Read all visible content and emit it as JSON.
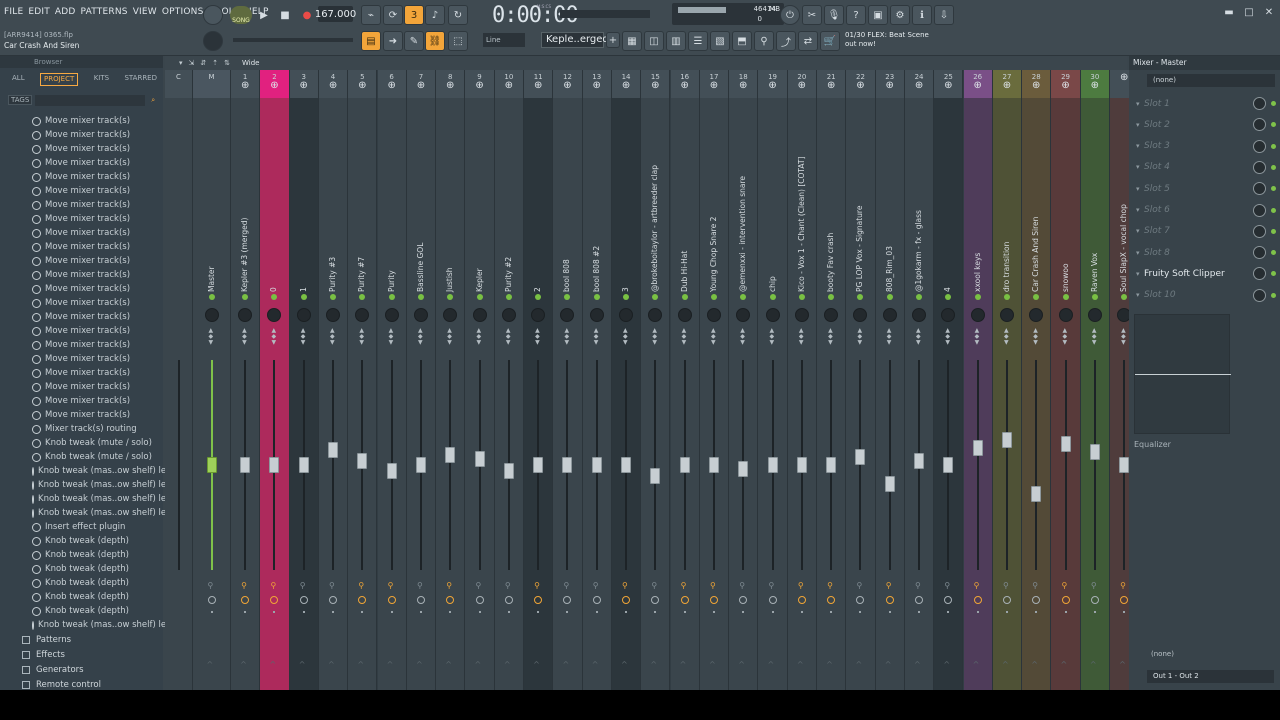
{
  "menu": [
    "FILE",
    "EDIT",
    "ADD",
    "PATTERNS",
    "VIEW",
    "OPTIONS",
    "TOOLS",
    "HELP"
  ],
  "transport": {
    "song_mode": "SONG",
    "tempo": "167.000",
    "time": "0:00:00",
    "time_unit": "M:S:CS",
    "memory_top": "14",
    "memory_label": "464 MB",
    "memory_bottom": "0"
  },
  "project": {
    "file": "[ARR9414] 0365.flp",
    "hint": "Car Crash And Siren"
  },
  "snap": "Line",
  "pattern": "Keple..erged)",
  "news": {
    "counter": "01/30",
    "text": "FLEX: Beat Scene out now!"
  },
  "browser": {
    "title": "Browser",
    "tabs": [
      "ALL",
      "PROJECT",
      "KITS",
      "STARRED"
    ],
    "active_tab": "PROJECT",
    "tags_label": "TAGS",
    "history": [
      "Move mixer track(s)",
      "Move mixer track(s)",
      "Move mixer track(s)",
      "Move mixer track(s)",
      "Move mixer track(s)",
      "Move mixer track(s)",
      "Move mixer track(s)",
      "Move mixer track(s)",
      "Move mixer track(s)",
      "Move mixer track(s)",
      "Move mixer track(s)",
      "Move mixer track(s)",
      "Move mixer track(s)",
      "Move mixer track(s)",
      "Move mixer track(s)",
      "Move mixer track(s)",
      "Move mixer track(s)",
      "Move mixer track(s)",
      "Move mixer track(s)",
      "Move mixer track(s)",
      "Move mixer track(s)",
      "Move mixer track(s)",
      "Mixer track(s) routing",
      "Knob tweak (mute / solo)",
      "Knob tweak (mute / solo)",
      "Knob tweak (mas..ow shelf) level)",
      "Knob tweak (mas..ow shelf) level)",
      "Knob tweak (mas..ow shelf) level)",
      "Knob tweak (mas..ow shelf) level)",
      "Insert effect plugin",
      "Knob tweak (depth)",
      "Knob tweak (depth)",
      "Knob tweak (depth)",
      "Knob tweak (depth)",
      "Knob tweak (depth)",
      "Knob tweak (depth)",
      "Knob tweak (mas..ow shelf) level)"
    ],
    "folders": [
      "Patterns",
      "Effects",
      "Generators",
      "Remote control"
    ]
  },
  "mixer": {
    "view_label": "Wide",
    "tracks": [
      {
        "num": "C",
        "name": "",
        "fader": 0.5
      },
      {
        "num": "M",
        "name": "Master",
        "fader": 0.5,
        "master": true
      },
      {
        "num": "1",
        "name": "Kepler #3 (merged)",
        "fader": 0.5
      },
      {
        "num": "2",
        "name": "0",
        "fader": 0.5,
        "color": "#ad2a5c",
        "hdr": "#e1217f"
      },
      {
        "num": "3",
        "name": "1",
        "fader": 0.5,
        "color": "#2c363c"
      },
      {
        "num": "4",
        "name": "Purity #3",
        "fader": 0.57
      },
      {
        "num": "5",
        "name": "Purity #7",
        "fader": 0.52
      },
      {
        "num": "6",
        "name": "Purity",
        "fader": 0.47
      },
      {
        "num": "7",
        "name": "Bassline GOL",
        "fader": 0.5
      },
      {
        "num": "8",
        "name": "Justish",
        "fader": 0.55
      },
      {
        "num": "9",
        "name": "Kepler",
        "fader": 0.53
      },
      {
        "num": "10",
        "name": "Purity #2",
        "fader": 0.47
      },
      {
        "num": "11",
        "name": "2",
        "fader": 0.5,
        "color": "#2c363c"
      },
      {
        "num": "12",
        "name": "bool 808",
        "fader": 0.5
      },
      {
        "num": "13",
        "name": "bool 808 #2",
        "fader": 0.5
      },
      {
        "num": "14",
        "name": "3",
        "fader": 0.5,
        "color": "#2c363c"
      },
      {
        "num": "15",
        "name": "@brokeboitaylor - artbreeder clap",
        "fader": 0.45
      },
      {
        "num": "16",
        "name": "Dub Hi-Hat",
        "fader": 0.5
      },
      {
        "num": "17",
        "name": "Young Chop Snare 2",
        "fader": 0.5
      },
      {
        "num": "18",
        "name": "@emenxxi - intervention snare",
        "fader": 0.48
      },
      {
        "num": "19",
        "name": "chip",
        "fader": 0.5
      },
      {
        "num": "20",
        "name": "Kico - Vox 1 - Chant (Clean) [COTAT]",
        "fader": 0.5
      },
      {
        "num": "21",
        "name": "booty Fav crash",
        "fader": 0.5
      },
      {
        "num": "22",
        "name": "PG LOP Vox - Signature",
        "fader": 0.54
      },
      {
        "num": "23",
        "name": "808_Rim_03",
        "fader": 0.41
      },
      {
        "num": "24",
        "name": "@1gokarm - fx - glass",
        "fader": 0.52
      },
      {
        "num": "25",
        "name": "4",
        "fader": 0.5,
        "color": "#2c363c"
      },
      {
        "num": "26",
        "name": "xxool keys",
        "fader": 0.58,
        "color": "#4f3c5a",
        "hdr": "#7a4f87"
      },
      {
        "num": "27",
        "name": "dro transition",
        "fader": 0.62,
        "color": "#4f5236",
        "hdr": "#6a6c3d"
      },
      {
        "num": "28",
        "name": "Car Crash And Siren",
        "fader": 0.36,
        "color": "#534a37",
        "hdr": "#6b5c3c"
      },
      {
        "num": "29",
        "name": "snowoo",
        "fader": 0.6,
        "color": "#583a3a",
        "hdr": "#7a4848"
      },
      {
        "num": "30",
        "name": "Raven Vox",
        "fader": 0.56,
        "color": "#3f5a37",
        "hdr": "#4d7b40"
      },
      {
        "num": "",
        "name": "Soul SlapX - vocal chop",
        "fader": 0.5,
        "color": "#4f3c3c"
      }
    ]
  },
  "mixer_panel": {
    "title": "Mixer - Master",
    "input": "(none)",
    "slots": [
      "Slot 1",
      "Slot 2",
      "Slot 3",
      "Slot 4",
      "Slot 5",
      "Slot 6",
      "Slot 7",
      "Slot 8",
      "Fruity Soft Clipper",
      "Slot 10"
    ],
    "eq_label": "Equalizer",
    "route_none": "(none)",
    "output": "Out 1 - Out 2"
  }
}
